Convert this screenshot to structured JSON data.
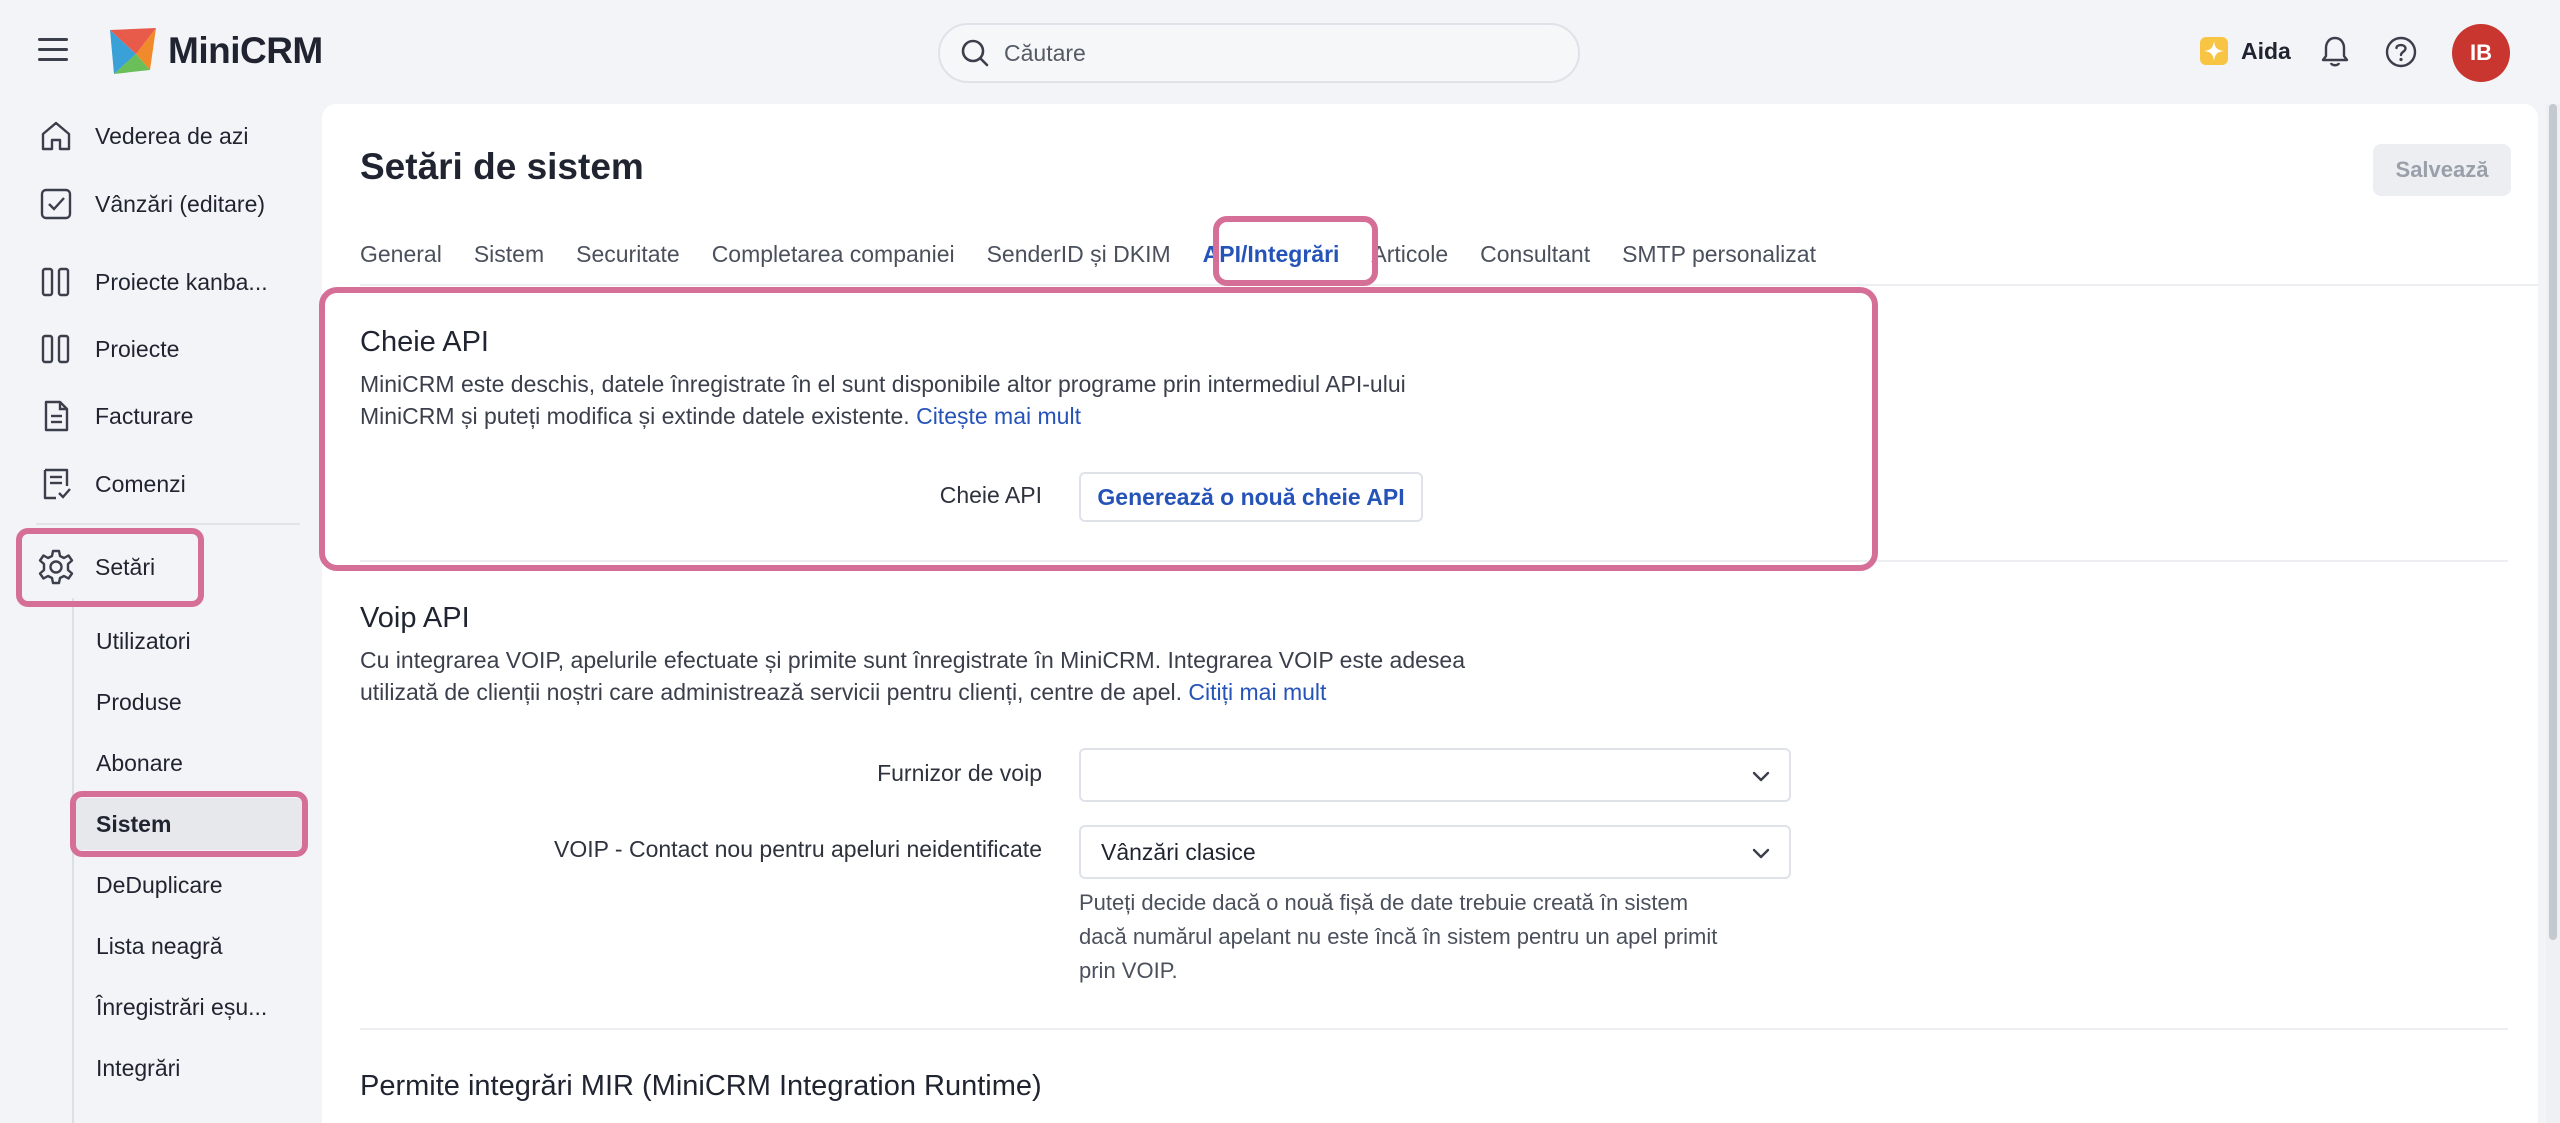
{
  "app": {
    "name": "MiniCRM",
    "search_placeholder": "Căutare",
    "aida_label": "Aida",
    "user_initials": "IB",
    "accent": "#2553b8",
    "highlight": "#d66f97",
    "avatar_color": "#c8362f"
  },
  "sidebar": {
    "items": [
      {
        "label": "Vederea de azi",
        "icon": "home-icon"
      },
      {
        "label": "Vânzări (editare)",
        "icon": "checkbox-icon"
      },
      {
        "label": "Proiecte kanba...",
        "icon": "kanban-icon"
      },
      {
        "label": "Proiecte",
        "icon": "kanban-icon"
      },
      {
        "label": "Facturare",
        "icon": "document-icon"
      },
      {
        "label": "Comenzi",
        "icon": "order-icon"
      },
      {
        "label": "Setări",
        "icon": "gear-icon"
      }
    ],
    "sub_items": [
      "Utilizatori",
      "Produse",
      "Abonare",
      "Sistem",
      "DeDuplicare",
      "Lista neagră",
      "Înregistrări eșu...",
      "Integrări"
    ]
  },
  "page": {
    "title": "Setări de sistem",
    "save_label": "Salvează",
    "tabs": [
      "General",
      "Sistem",
      "Securitate",
      "Completarea companiei",
      "SenderID și DKIM",
      "API/Integrări",
      "Articole",
      "Consultant",
      "SMTP personalizat"
    ],
    "active_tab": "API/Integrări"
  },
  "api_section": {
    "title": "Cheie API",
    "desc_line1": "MiniCRM este deschis, datele înregistrate în el sunt disponibile altor programe prin intermediul API-ului",
    "desc_line2": "MiniCRM și puteți modifica și extinde datele existente.",
    "read_more": "Citește mai mult",
    "field_label": "Cheie API",
    "button_label": "Generează o nouă cheie API"
  },
  "voip_section": {
    "title": "Voip API",
    "desc_line1": "Cu integrarea VOIP, apelurile efectuate și primite sunt înregistrate în MiniCRM. Integrarea VOIP este adesea",
    "desc_line2": "utilizată de clienții noștri care administrează servicii pentru clienți, centre de apel.",
    "read_more": "Citiți mai mult",
    "provider_label": "Furnizor de voip",
    "provider_value": "",
    "contact_label": "VOIP - Contact nou pentru apeluri neidentificate",
    "contact_value": "Vânzări clasice",
    "help_line1": "Puteți decide dacă o nouă fișă de date trebuie creată în sistem",
    "help_line2": "dacă numărul apelant nu este încă în sistem pentru un apel primit",
    "help_line3": "prin VOIP."
  },
  "mir_section": {
    "title": "Permite integrări MIR (MiniCRM Integration Runtime)"
  }
}
